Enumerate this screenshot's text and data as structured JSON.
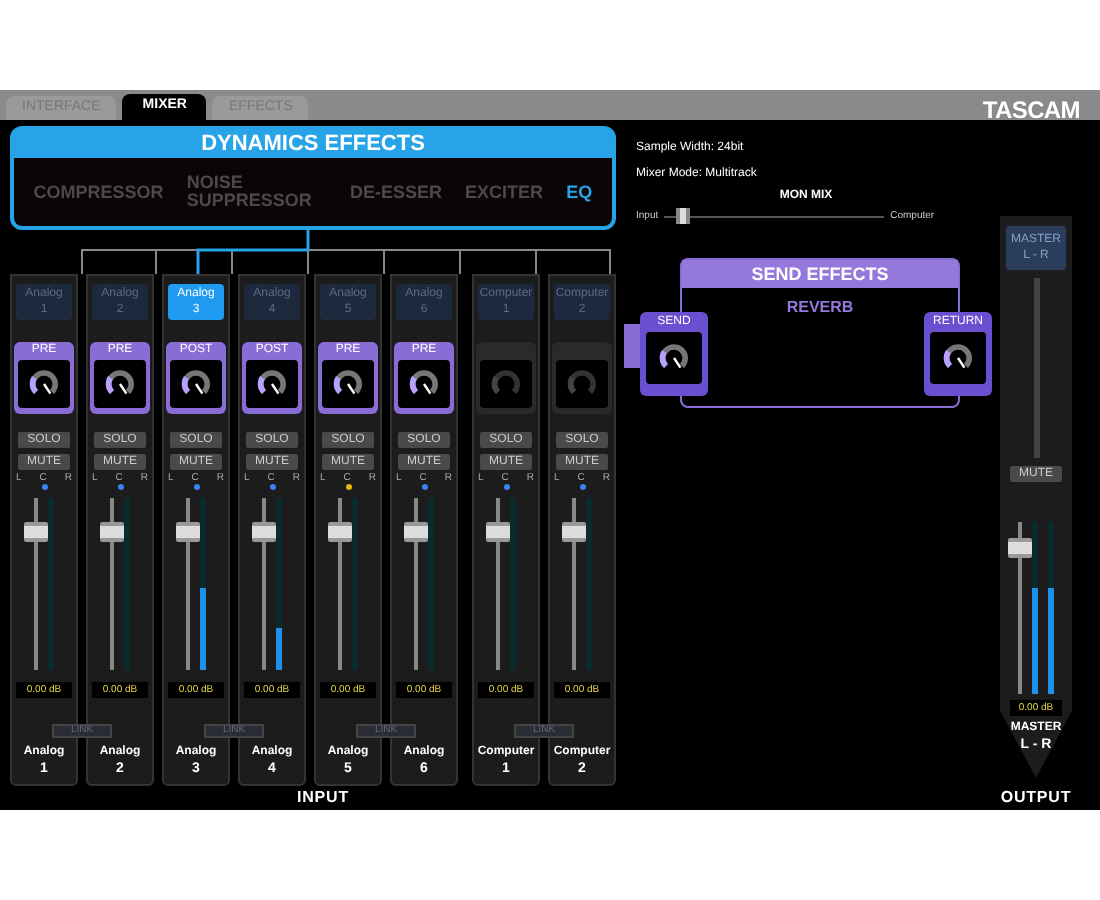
{
  "tabs": [
    {
      "label": "INTERFACE",
      "selected": false
    },
    {
      "label": "MIXER",
      "selected": true
    },
    {
      "label": "EFFECTS",
      "selected": false
    }
  ],
  "logo": "TASCAM",
  "dynamics": {
    "title": "DYNAMICS EFFECTS",
    "items": [
      {
        "label": "COMPRESSOR",
        "selected": false
      },
      {
        "label": "NOISE SUPPRESSOR",
        "selected": false
      },
      {
        "label": "DE-ESSER",
        "selected": false
      },
      {
        "label": "EXCITER",
        "selected": false
      },
      {
        "label": "EQ",
        "selected": true
      }
    ]
  },
  "info": [
    "Sample Width: 24bit",
    "Mixer Mode: Multitrack"
  ],
  "mon_mix": {
    "title": "MON MIX",
    "left": "Input",
    "right": "Computer",
    "level": 0.05
  },
  "pairs": [
    {
      "link": "LINK",
      "channels": [
        {
          "button": [
            "Analog",
            "1"
          ],
          "selected": false,
          "tap": "PRE",
          "knob_active": true,
          "solo": "SOLO",
          "mute": "MUTE",
          "pan": {
            "labels": [
              "L",
              "C",
              "R"
            ],
            "color": "#3b82f6"
          },
          "fader": {
            "level": 0.8
          },
          "meter": {
            "level": 0
          },
          "gain": "0.00 dB",
          "name": [
            "Analog",
            "1"
          ]
        },
        {
          "button": [
            "Analog",
            "2"
          ],
          "selected": false,
          "tap": "PRE",
          "knob_active": true,
          "solo": "SOLO",
          "mute": "MUTE",
          "pan": {
            "labels": [
              "L",
              "C",
              "R"
            ],
            "color": "#3b82f6"
          },
          "fader": {
            "level": 0.8
          },
          "meter": {
            "level": 0
          },
          "gain": "0.00 dB",
          "name": [
            "Analog",
            "2"
          ]
        }
      ]
    },
    {
      "link": "LINK",
      "channels": [
        {
          "button": [
            "Analog",
            "3"
          ],
          "selected": true,
          "tap": "POST",
          "knob_active": true,
          "solo": "SOLO",
          "mute": "MUTE",
          "pan": {
            "labels": [
              "L",
              "C",
              "R"
            ],
            "color": "#3b82f6"
          },
          "fader": {
            "level": 0.8
          },
          "meter": {
            "level": 0.48
          },
          "gain": "0.00 dB",
          "name": [
            "Analog",
            "3"
          ]
        },
        {
          "button": [
            "Analog",
            "4"
          ],
          "selected": false,
          "tap": "POST",
          "knob_active": true,
          "solo": "SOLO",
          "mute": "MUTE",
          "pan": {
            "labels": [
              "L",
              "C",
              "R"
            ],
            "color": "#3b82f6"
          },
          "fader": {
            "level": 0.8
          },
          "meter": {
            "level": 0.24
          },
          "gain": "0.00 dB",
          "name": [
            "Analog",
            "4"
          ]
        }
      ]
    },
    {
      "link": "LINK",
      "channels": [
        {
          "button": [
            "Analog",
            "5"
          ],
          "selected": false,
          "tap": "PRE",
          "knob_active": true,
          "solo": "SOLO",
          "mute": "MUTE",
          "pan": {
            "labels": [
              "L",
              "C",
              "R"
            ],
            "color": "#eab308"
          },
          "fader": {
            "level": 0.8
          },
          "meter": {
            "level": 0
          },
          "gain": "0.00 dB",
          "name": [
            "Analog",
            "5"
          ]
        },
        {
          "button": [
            "Analog",
            "6"
          ],
          "selected": false,
          "tap": "PRE",
          "knob_active": true,
          "solo": "SOLO",
          "mute": "MUTE",
          "pan": {
            "labels": [
              "L",
              "C",
              "R"
            ],
            "color": "#3b82f6"
          },
          "fader": {
            "level": 0.8
          },
          "meter": {
            "level": 0
          },
          "gain": "0.00 dB",
          "name": [
            "Analog",
            "6"
          ]
        }
      ]
    },
    {
      "link": "LINK",
      "channels": [
        {
          "button": [
            "Computer",
            "1"
          ],
          "selected": false,
          "knob_active": false,
          "solo": "SOLO",
          "mute": "MUTE",
          "pan": {
            "labels": [
              "L",
              "C",
              "R"
            ],
            "color": "#3b82f6"
          },
          "fader": {
            "level": 0.8
          },
          "meter": {
            "level": 0
          },
          "gain": "0.00 dB",
          "name": [
            "Computer",
            "1"
          ]
        },
        {
          "button": [
            "Computer",
            "2"
          ],
          "selected": false,
          "knob_active": false,
          "solo": "SOLO",
          "mute": "MUTE",
          "pan": {
            "labels": [
              "L",
              "C",
              "R"
            ],
            "color": "#3b82f6"
          },
          "fader": {
            "level": 0.8
          },
          "meter": {
            "level": 0
          },
          "gain": "0.00 dB",
          "name": [
            "Computer",
            "2"
          ]
        }
      ]
    }
  ],
  "input_label": "INPUT",
  "send_effects": {
    "title": "SEND EFFECTS",
    "effect": "REVERB",
    "send": "SEND",
    "return": "RETURN"
  },
  "master": {
    "button": [
      "MASTER",
      "L - R"
    ],
    "mute": "MUTE",
    "fader": {
      "level": 0.85
    },
    "meters": [
      {
        "level": 0.62
      },
      {
        "level": 0.62
      }
    ],
    "gain": "0.00 dB",
    "name": [
      "MASTER",
      "L - R"
    ]
  },
  "output_label": "OUTPUT"
}
